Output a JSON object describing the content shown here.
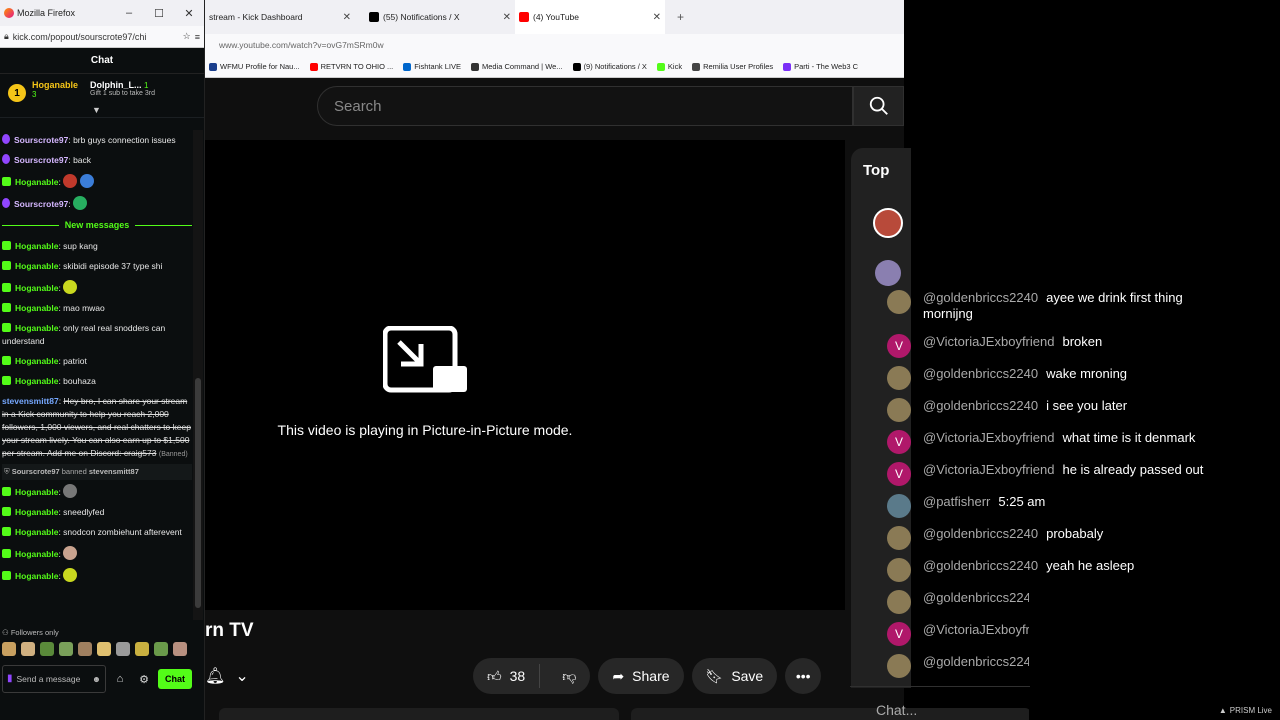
{
  "kick_window": {
    "title": "Mozilla Firefox",
    "url": "kick.com/popout/sourscrote97/chi",
    "header": "Chat",
    "top_gifter": {
      "rank": "1",
      "name": "Hoganable",
      "count": "3"
    },
    "second_gifter": {
      "name": "Dolphin_L...",
      "count": "1",
      "sub": "Gift 1 sub to take 3rd"
    },
    "messages": [
      {
        "user": "Sourscrote97",
        "text": ": brb guys connection issues",
        "color": "purple"
      },
      {
        "user": "Sourscrote97",
        "text": ": back",
        "color": "purple"
      },
      {
        "user": "Hoganable",
        "text": ":",
        "color": "green",
        "emotes": [
          "#c0392b",
          "#3b7dd8"
        ]
      },
      {
        "user": "Sourscrote97",
        "text": ":",
        "color": "purple",
        "emotes": [
          "#27ae60"
        ]
      }
    ],
    "new_messages_label": "New messages",
    "messages2": [
      {
        "user": "Hoganable",
        "text": ": sup kang"
      },
      {
        "user": "Hoganable",
        "text": ": skibidi episode 37 type shi"
      },
      {
        "user": "Hoganable",
        "text": ":",
        "emotes": [
          "#c9d81f"
        ]
      },
      {
        "user": "Hoganable",
        "text": ": mao mwao"
      },
      {
        "user": "Hoganable",
        "text": ": only real real snodders can understand"
      },
      {
        "user": "Hoganable",
        "text": ": patriot"
      },
      {
        "user": "Hoganable",
        "text": ": bouhaza"
      }
    ],
    "spam_message": {
      "user": "stevensmitt87",
      "text": "Hey bro, I can share your stream in a Kick community to help you reach 2,000 followers, 1,000 viewers, and real chatters to keep your stream lively. You can also earn up to $1,500 per stream. Add me on Discord: craig573",
      "banned_tag": "(Banned)"
    },
    "ban_notice": {
      "actor": "Sourscrote97",
      "verb": "banned",
      "target": "stevensmitt87"
    },
    "messages3": [
      {
        "user": "Hoganable",
        "text": ":",
        "emotes": [
          "#777777"
        ]
      },
      {
        "user": "Hoganable",
        "text": ": sneedlyfed"
      },
      {
        "user": "Hoganable",
        "text": ": snodcon zombiehunt afterevent"
      },
      {
        "user": "Hoganable",
        "text": ":",
        "emotes": [
          "#c9a38f"
        ]
      },
      {
        "user": "Hoganable",
        "text": ":",
        "emotes": [
          "#c9d81f"
        ]
      }
    ],
    "followers_only": "Followers only",
    "send_placeholder": "Send a message",
    "chat_button": "Chat"
  },
  "browser": {
    "tabs": [
      {
        "label": "stream - Kick Dashboard",
        "color": "#53fc18"
      },
      {
        "label": "(55) Notifications / X",
        "color": "#000000"
      },
      {
        "label": "(4) YouTube",
        "color": "#ff0000"
      }
    ],
    "url": "www.youtube.com/watch?v=ovG7mSRm0w",
    "bookmarks": [
      {
        "label": "WFMU Profile for Nau...",
        "color": "#1a3e8c"
      },
      {
        "label": "RETVRN TO OHIO ...",
        "color": "#ff0000"
      },
      {
        "label": "Fishtank LIVE",
        "color": "#0066cc"
      },
      {
        "label": "Media Command | We...",
        "color": "#333333"
      },
      {
        "label": "(9) Notifications / X",
        "color": "#000000"
      },
      {
        "label": "Kick",
        "color": "#53fc18"
      },
      {
        "label": "Remilia User Profiles",
        "color": "#444444"
      },
      {
        "label": "Parti - The Web3 C",
        "color": "#7b2ff7"
      }
    ],
    "search_placeholder": "Search",
    "pip_message": "This video is playing in Picture-in-Picture mode.",
    "channel_partial": "rn TV",
    "likes": "38",
    "share": "Share",
    "save": "Save",
    "chat_top": "Top"
  },
  "live_chat": [
    {
      "user": "@goldenbriccs2240",
      "text": "ayee we drink first thing mornijng",
      "avatar": "#8a7a55",
      "letter": ""
    },
    {
      "user": "@VictoriaJExboyfriend",
      "text": "broken",
      "avatar": "#b0186a",
      "letter": "V"
    },
    {
      "user": "@goldenbriccs2240",
      "text": "wake mroning",
      "avatar": "#8a7a55",
      "letter": ""
    },
    {
      "user": "@goldenbriccs2240",
      "text": "i see you later",
      "avatar": "#8a7a55",
      "letter": ""
    },
    {
      "user": "@VictoriaJExboyfriend",
      "text": "what time is it denmark",
      "avatar": "#b0186a",
      "letter": "V"
    },
    {
      "user": "@VictoriaJExboyfriend",
      "text": "he is already passed out",
      "avatar": "#b0186a",
      "letter": "V"
    },
    {
      "user": "@patfisherr",
      "text": "5:25 am",
      "avatar": "#5a7a8a",
      "letter": ""
    },
    {
      "user": "@goldenbriccs2240",
      "text": "probabaly",
      "avatar": "#8a7a55",
      "letter": ""
    },
    {
      "user": "@goldenbriccs2240",
      "text": "yeah he asleep",
      "avatar": "#8a7a55",
      "letter": ""
    },
    {
      "user": "@goldenbriccs224",
      "text": "",
      "avatar": "#8a7a55",
      "letter": ""
    },
    {
      "user": "@VictoriaJExboyfri",
      "text": "",
      "avatar": "#b0186a",
      "letter": "V"
    },
    {
      "user": "@goldenbriccs224",
      "text": "",
      "avatar": "#8a7a55",
      "letter": ""
    }
  ],
  "chat_input_placeholder": "Chat...",
  "prism_label": "PRISM Live"
}
